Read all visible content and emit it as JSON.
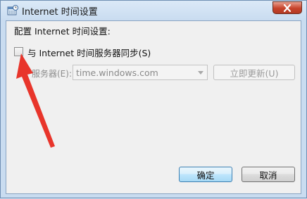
{
  "window": {
    "title": "Internet 时间设置",
    "close_icon": "close-icon"
  },
  "dialog": {
    "heading": "配置 Internet 时间设置:",
    "sync_checkbox": {
      "label": "与 Internet 时间服务器同步(S)",
      "checked": false
    },
    "server": {
      "label": "服务器(E):",
      "value": "time.windows.com",
      "enabled": false
    },
    "update_button": "立即更新(U)",
    "ok_button": "确定",
    "cancel_button": "取消"
  },
  "annotation": {
    "arrow_color": "#e8352b"
  }
}
